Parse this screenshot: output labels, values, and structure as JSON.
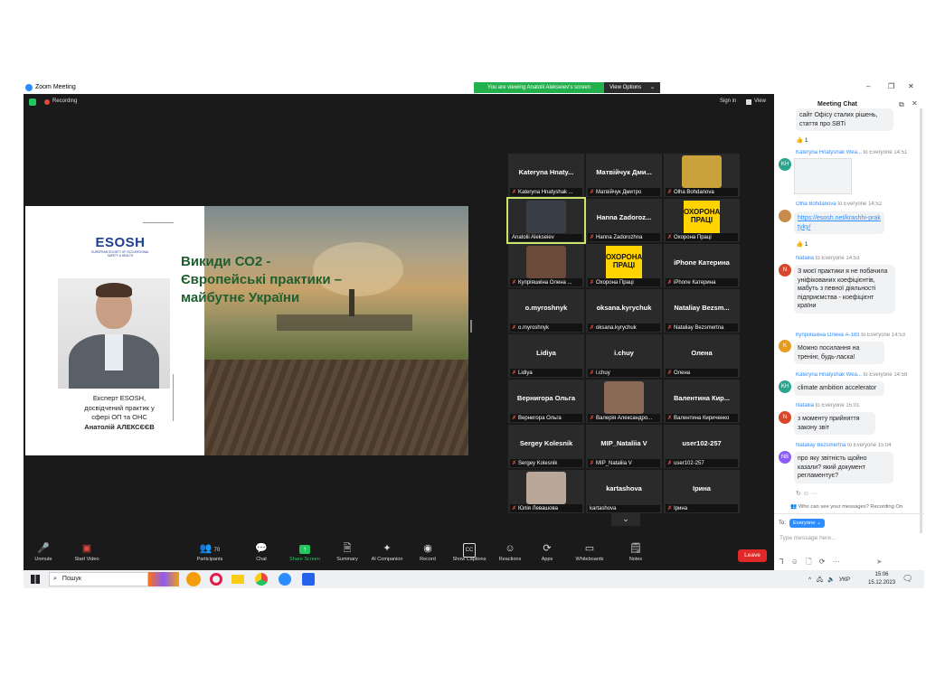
{
  "window": {
    "title": "Zoom Meeting",
    "controls": [
      "–",
      "❐",
      "✕"
    ]
  },
  "banner": {
    "text": "You are viewing Anatolii Alekseiev's screen",
    "view_options": "View Options",
    "chevron": "⌄"
  },
  "topbar": {
    "recording": "Recording",
    "sign_in": "Sign in",
    "view": "View"
  },
  "slide": {
    "logo": "ESOSH",
    "logo_sub": "EUROPEAN SOCIETY OF OCCUPATIONAL SAFETY & HEALTH",
    "title_line1": "Викиди СО2 -",
    "title_line2": "Європейські практики –",
    "title_line3": "майбутнє України",
    "caption_line1": "Експерт ESOSH,",
    "caption_line2": "досвідчений практик у",
    "caption_line3": "сфері ОП та ОНС",
    "caption_name": "Анатолій АЛЕКСЄЄВ"
  },
  "tiles": [
    {
      "name": "Kateryna Hnaty...",
      "label": "Kateryna Hnatyshak ...",
      "muted": true
    },
    {
      "name": "Матвійчук Дми...",
      "label": "Матвійчук Дмитро",
      "muted": true
    },
    {
      "name": "",
      "label": "Olha Bohdanova",
      "muted": true,
      "photo": "#c9a23b"
    },
    {
      "name": "",
      "label": "Anatolii Alekseiev",
      "muted": false,
      "photo": "#3a3f47",
      "active": true
    },
    {
      "name": "Hanna Zadoroz...",
      "label": "Hanna Zadorozhna",
      "muted": true
    },
    {
      "name": "",
      "label": "Охорона Праці",
      "muted": true,
      "ohorona": "ОХОРОНА ПРАЦІ"
    },
    {
      "name": "",
      "label": "Купріяшкіна Олена ...",
      "muted": true,
      "photo": "#6b4a3a"
    },
    {
      "name": "",
      "label": "Охорона Праці",
      "muted": true,
      "ohorona": "ОХОРОНА ПРАЦІ"
    },
    {
      "name": "iPhone Катерина",
      "label": "iPhone Катерина",
      "muted": true
    },
    {
      "name": "o.myroshnyk",
      "label": "o.myroshnyk",
      "muted": true
    },
    {
      "name": "oksana.kyrychuk",
      "label": "oksana.kyrychuk",
      "muted": true
    },
    {
      "name": "Nataliay Bezsm...",
      "label": "Nataliay Bezsmertna",
      "muted": true
    },
    {
      "name": "Lidiya",
      "label": "Lidiya",
      "muted": true
    },
    {
      "name": "i.chuy",
      "label": "i.chuy",
      "muted": true
    },
    {
      "name": "Олена",
      "label": "Олена",
      "muted": true
    },
    {
      "name": "Вернигора Ольга",
      "label": "Вернигора Ольга",
      "muted": true
    },
    {
      "name": "",
      "label": "Валерія Александро...",
      "muted": true,
      "photo": "#8a6a56"
    },
    {
      "name": "Валентина Кир...",
      "label": "Валентина Кириченко",
      "muted": true
    },
    {
      "name": "Sergey Kolesnik",
      "label": "Sergey Kolesnik",
      "muted": true
    },
    {
      "name": "MIP_Nataliia V",
      "label": "MIP_Nataliia V",
      "muted": true
    },
    {
      "name": "user102-257",
      "label": "user102-257",
      "muted": true
    },
    {
      "name": "",
      "label": "Юлія Левашова",
      "muted": true,
      "photo": "#b9a79a"
    },
    {
      "name": "kartashova",
      "label": "kartashova",
      "muted": false
    },
    {
      "name": "Ірина",
      "label": "Ірина",
      "muted": true
    }
  ],
  "more_chevron": "⌄",
  "toolbar": {
    "unmute": "Unmute",
    "start_video": "Start Video",
    "participants": "Participants",
    "participants_count": "70",
    "chat": "Chat",
    "share_screen": "Share Screen",
    "summary": "Summary",
    "ai_companion": "AI Companion",
    "record": "Record",
    "show_captions": "Show Captions",
    "reactions": "Reactions",
    "apps": "Apps",
    "whiteboards": "Whiteboards",
    "notes": "Notes",
    "leave": "Leave"
  },
  "chat": {
    "title": "Meeting Chat",
    "top_text_line1": "сайт Офісу сталих рішень,",
    "top_text_line2": "стаття про SBTi",
    "reaction1": "👍 1",
    "m1_meta": "Kateryna Hnatyshak Wea...",
    "m1_to": "to Everyone",
    "m1_time": "14:51",
    "m1_avatar": "KH",
    "m2_meta": "Olha Bohdanova",
    "m2_to": "to Everyone",
    "m2_time": "14:52",
    "m2_link": "https://esosh.net/krashhi-praktyky/",
    "reaction2": "👍 1",
    "m3_meta": "Nataliia",
    "m3_to": "to Everyone",
    "m3_time": "14:53",
    "m3_avatar": "N",
    "m3_text": "З моєї практики я не побачила уніфікованих коефіцієнтів, мабуть з певної діяльності підприємства - коефіцієнт країни",
    "m4_meta": "Купріяшкіна Олена А-183",
    "m4_to": "to Everyone",
    "m4_time": "14:53",
    "m4_avatar": "K",
    "m4_text": "Можно посилання на тренінг, будь-ласка!",
    "m5_meta": "Kateryna Hnatyshak Wea...",
    "m5_to": "to Everyone",
    "m5_time": "14:58",
    "m5_avatar": "KH",
    "m5_text": "climate ambition accelerator",
    "m6_meta": "Nataliia",
    "m6_to": "to Everyone",
    "m6_time": "15:01",
    "m6_avatar": "N",
    "m6_text": "з моменту прийняття закону звіт",
    "m7_meta": "Nataliay Bezsmertna",
    "m7_to": "to Everyone",
    "m7_time": "15:04",
    "m7_avatar": "NB",
    "m7_text": "про яку звітність щойно казали? який документ регламентує?",
    "who_can_see": "Who can see your messages? Recording On",
    "to_label": "To:",
    "to_value": "Everyone",
    "input_placeholder": "Type message here..."
  },
  "taskbar": {
    "search": "Пошук",
    "lang": "УКР",
    "time": "15:06",
    "date": "15.12.2023"
  },
  "colors": {
    "banner_green": "#23b14d",
    "leave_red": "#e02828",
    "share_green": "#22c55e",
    "chat_link": "#2d8cff"
  }
}
